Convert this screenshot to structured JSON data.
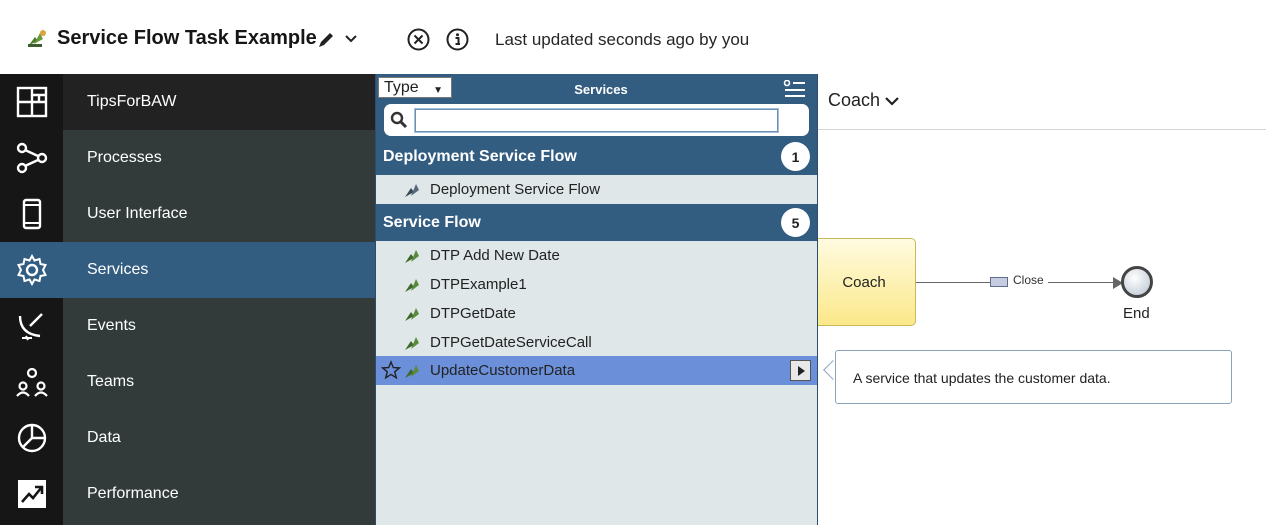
{
  "header": {
    "title": "Service Flow Task Example",
    "last_updated": "Last updated seconds ago by you"
  },
  "rail": {
    "icons": [
      "dashboard-icon",
      "processes-icon",
      "mobile-icon",
      "gear-icon",
      "satellite-icon",
      "teams-icon",
      "pie-chart-icon",
      "trend-chart-icon"
    ]
  },
  "nav": {
    "items": [
      {
        "label": "TipsForBAW"
      },
      {
        "label": "Processes"
      },
      {
        "label": "User Interface"
      },
      {
        "label": "Services"
      },
      {
        "label": "Events"
      },
      {
        "label": "Teams"
      },
      {
        "label": "Data"
      },
      {
        "label": "Performance"
      }
    ],
    "active": "Services"
  },
  "popup": {
    "type_select": "Type",
    "title": "Services",
    "search_value": "",
    "groups": [
      {
        "name": "Deployment Service Flow",
        "count": "1",
        "items": [
          "Deployment Service Flow"
        ]
      },
      {
        "name": "Service Flow",
        "count": "5",
        "items": [
          "DTP Add New Date",
          "DTPExample1",
          "DTPGetDate",
          "DTPGetDateServiceCall",
          "UpdateCustomerData"
        ]
      }
    ],
    "selected_item": "UpdateCustomerData"
  },
  "canvas": {
    "view_dropdown": "Coach",
    "coach_node": "Coach",
    "flow_label": "Close",
    "end_label": "End",
    "tooltip": "A service that updates the customer data."
  },
  "colors": {
    "nav_active": "#325c80",
    "popup_head": "#325c80",
    "selected_row": "#6b8fd9",
    "rail_bg": "#161616",
    "nav_bg": "#323a3a"
  }
}
